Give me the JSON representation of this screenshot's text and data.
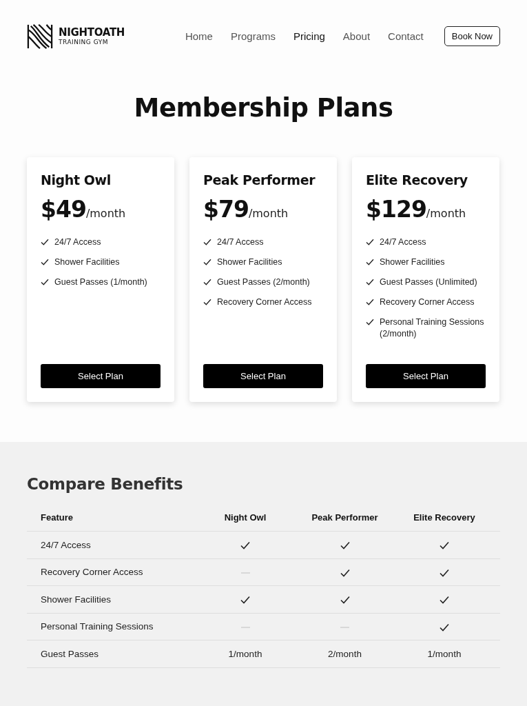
{
  "brand": {
    "name": "NIGHTOATH",
    "tagline": "TRAINING GYM"
  },
  "nav": [
    {
      "label": "Home",
      "selected": false
    },
    {
      "label": "Programs",
      "selected": false
    },
    {
      "label": "Pricing",
      "selected": true
    },
    {
      "label": "About",
      "selected": false
    },
    {
      "label": "Contact",
      "selected": false
    }
  ],
  "book_button": "Book Now",
  "heading": "Membership Plans",
  "plans": [
    {
      "name": "Night Owl",
      "price": "$49",
      "period": "/month",
      "features": [
        "24/7 Access",
        "Shower Facilities",
        "Guest Passes (1/month)"
      ],
      "button": "Select Plan"
    },
    {
      "name": "Peak Performer",
      "price": "$79",
      "period": "/month",
      "features": [
        "24/7 Access",
        "Shower Facilities",
        "Guest Passes (2/month)",
        "Recovery Corner Access"
      ],
      "button": "Select Plan"
    },
    {
      "name": "Elite Recovery",
      "price": "$129",
      "period": "/month",
      "features": [
        "24/7 Access",
        "Shower Facilities",
        "Guest Passes (Unlimited)",
        "Recovery Corner Access",
        "Personal Training Sessions (2/month)"
      ],
      "button": "Select Plan"
    }
  ],
  "compare": {
    "title": "Compare Benefits",
    "columns": [
      "Feature",
      "Night Owl",
      "Peak Performer",
      "Elite Recovery"
    ],
    "rows": [
      {
        "cells": [
          {
            "kind": "text",
            "text": "24/7 Access"
          },
          {
            "kind": "check"
          },
          {
            "kind": "check"
          },
          {
            "kind": "check"
          }
        ]
      },
      {
        "cells": [
          {
            "kind": "text",
            "text": "Recovery Corner Access"
          },
          {
            "kind": "dash"
          },
          {
            "kind": "check"
          },
          {
            "kind": "check"
          }
        ]
      },
      {
        "cells": [
          {
            "kind": "text",
            "text": "Shower Facilities"
          },
          {
            "kind": "check"
          },
          {
            "kind": "check"
          },
          {
            "kind": "check"
          }
        ]
      },
      {
        "cells": [
          {
            "kind": "text",
            "text": "Personal Training Sessions"
          },
          {
            "kind": "dash"
          },
          {
            "kind": "dash"
          },
          {
            "kind": "check"
          }
        ]
      },
      {
        "cells": [
          {
            "kind": "text",
            "text": "Guest Passes"
          },
          {
            "kind": "text",
            "text": "1/month"
          },
          {
            "kind": "text",
            "text": "2/month"
          },
          {
            "kind": "text",
            "text": "1/month"
          }
        ]
      }
    ]
  }
}
